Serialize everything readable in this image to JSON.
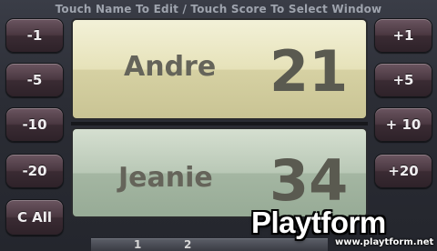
{
  "header": {
    "instructions": "Touch Name To Edit / Touch Score To Select Window"
  },
  "left_buttons": [
    "-1",
    "-5",
    "-10",
    "-20",
    "C All"
  ],
  "right_buttons": [
    "+1",
    "+5",
    "+ 10",
    "+20"
  ],
  "players": [
    {
      "name": "Andre",
      "score": "21"
    },
    {
      "name": "Jeanie",
      "score": "34"
    }
  ],
  "watermark": {
    "logo": "Playtform",
    "url": "www.playtform.net"
  },
  "bottom_tabs": [
    "1",
    "2"
  ],
  "colors": {
    "panel_top": "#e6e2b9",
    "panel_bottom": "#b9c8b6",
    "button": "#4a3841"
  }
}
